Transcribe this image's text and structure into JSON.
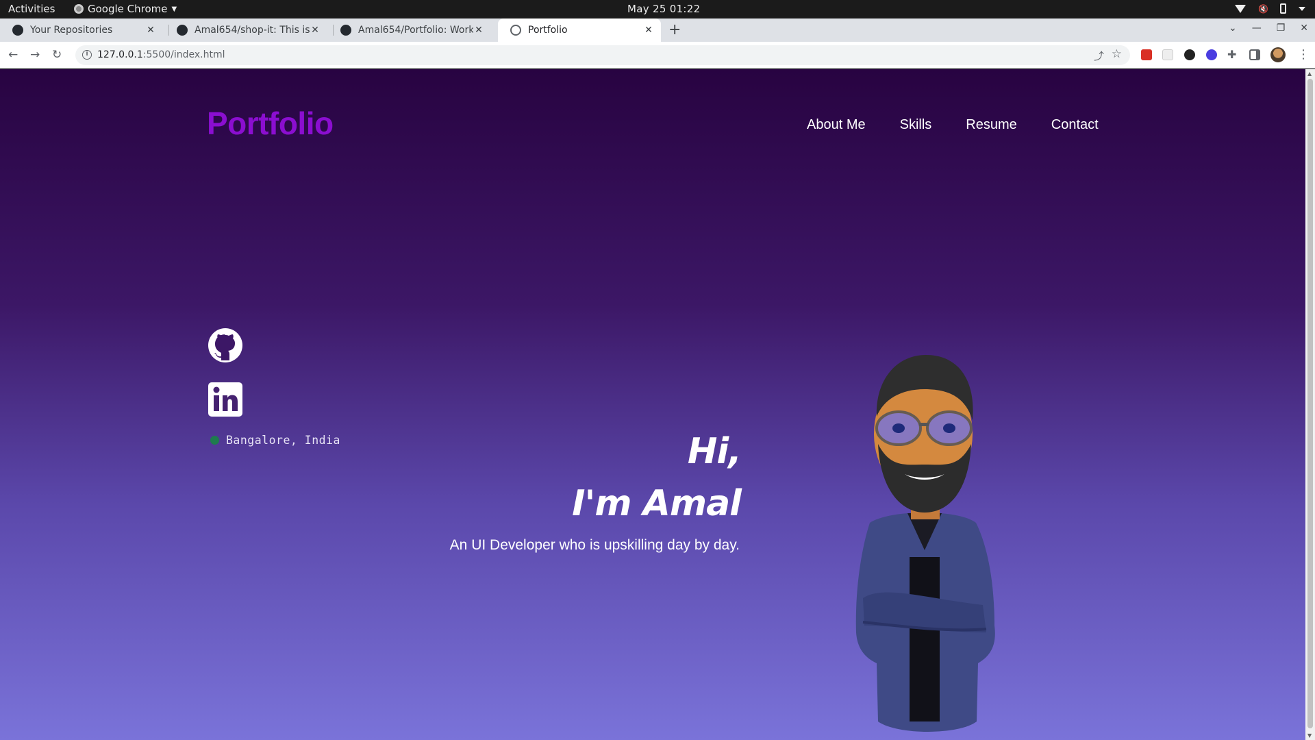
{
  "system": {
    "activities": "Activities",
    "app_name": "Google Chrome",
    "clock": "May 25  01:22"
  },
  "browser": {
    "tabs": [
      {
        "title": "Your Repositories",
        "favicon": "github-icon",
        "active": false
      },
      {
        "title": "Amal654/shop-it: This is a",
        "favicon": "github-icon",
        "active": false
      },
      {
        "title": "Amal654/Portfolio: Work",
        "favicon": "github-icon",
        "active": false
      },
      {
        "title": "Portfolio",
        "favicon": "globe-icon",
        "active": true
      }
    ],
    "url_host": "127.0.0.1",
    "url_path": ":5500/index.html"
  },
  "page": {
    "brand": "Portfolio",
    "nav": [
      "About Me",
      "Skills",
      "Resume",
      "Contact"
    ],
    "location": "Bangalore, India",
    "greeting_line1": "Hi,",
    "greeting_line2": "I'm Amal",
    "tagline": "An UI Developer who is upskilling day by day."
  },
  "colors": {
    "brand": "#8b0ed0",
    "gradient_top": "#280341",
    "gradient_bottom": "#7a73d9",
    "location_dot": "#1e7b4e"
  }
}
